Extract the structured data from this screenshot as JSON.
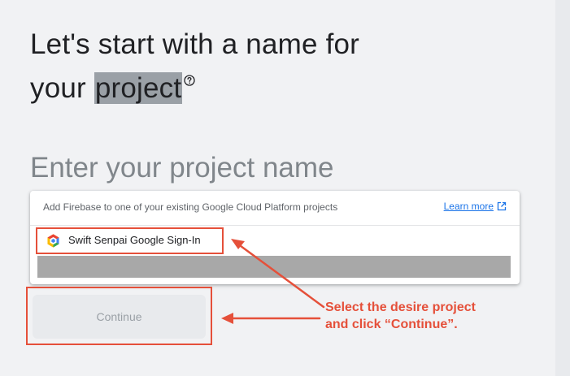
{
  "title": {
    "line1": "Let's start with a name for",
    "line2_prefix": "your ",
    "line2_highlight": "project"
  },
  "icons": {
    "help": "help-circle-icon",
    "gcp": "google-cloud-icon",
    "external_link": "open-in-new-icon"
  },
  "name_input": {
    "placeholder": "Enter your project name"
  },
  "dropdown": {
    "hint": "Add Firebase to one of your existing Google Cloud Platform projects",
    "learn_more": "Learn more",
    "items": [
      {
        "label": "Swift Senpai Google Sign-In"
      }
    ]
  },
  "continue_button": {
    "label": "Continue"
  },
  "annotation": {
    "line1": "Select the desire project",
    "line2": "and click “Continue”."
  },
  "colors": {
    "accent_red": "#e5503a",
    "link_blue": "#1a73e8",
    "background": "#f1f2f4"
  }
}
